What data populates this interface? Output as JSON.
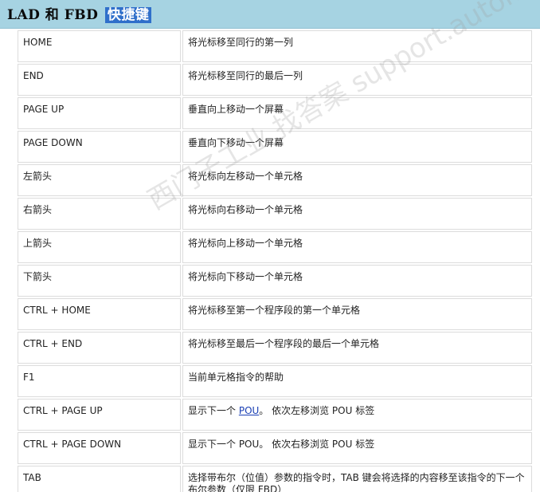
{
  "header": {
    "title_main": "LAD 和 FBD",
    "title_highlight": "快捷键"
  },
  "rows": [
    {
      "key": "HOME",
      "desc": "将光标移至同行的第一列"
    },
    {
      "key": "END",
      "desc": "将光标移至同行的最后一列"
    },
    {
      "key": "PAGE UP",
      "desc": "垂直向上移动一个屏幕"
    },
    {
      "key": "PAGE DOWN",
      "desc": "垂直向下移动一个屏幕"
    },
    {
      "key": "左箭头",
      "desc": "将光标向左移动一个单元格"
    },
    {
      "key": "右箭头",
      "desc": "将光标向右移动一个单元格"
    },
    {
      "key": "上箭头",
      "desc": "将光标向上移动一个单元格"
    },
    {
      "key": "下箭头",
      "desc": "将光标向下移动一个单元格"
    },
    {
      "key": "CTRL + HOME",
      "desc": "将光标移至第一个程序段的第一个单元格"
    },
    {
      "key": "CTRL + END",
      "desc": "将光标移至最后一个程序段的最后一个单元格"
    },
    {
      "key": "F1",
      "desc": "当前单元格指令的帮助"
    },
    {
      "key": "CTRL + PAGE UP",
      "desc_pre": "显示下一个 ",
      "desc_link": "POU",
      "desc_post": "。 依次左移浏览 POU 标签"
    },
    {
      "key": "CTRL + PAGE DOWN",
      "desc": "显示下一个 POU。 依次右移浏览 POU 标签"
    },
    {
      "key": "TAB",
      "desc": "选择带布尔（位值）参数的指令时，TAB 键会将选择的内容移至该指令的下一个布尔参数（仅限 FBD）"
    }
  ],
  "watermark": "西门子工业 找答案 support.automation.siemens.com.cn"
}
